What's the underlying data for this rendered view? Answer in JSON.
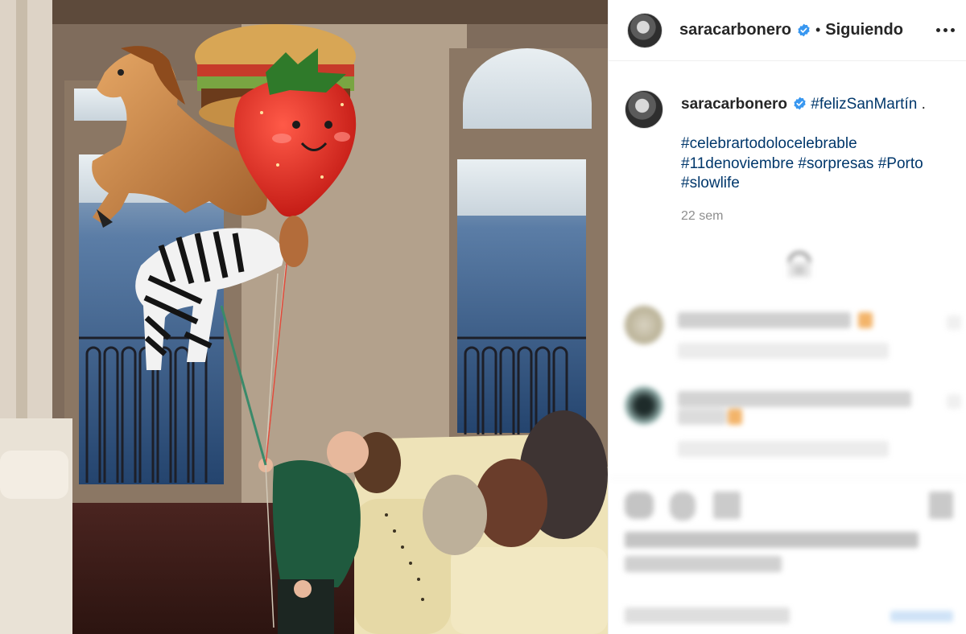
{
  "post": {
    "username": "saracarbonero",
    "separator": "•",
    "follow_status": "Siguiendo",
    "caption": {
      "username": "saracarbonero",
      "first_tag": "#felizSanMartín",
      "first_line_end": ".",
      "tags": [
        "#celebrartodolocelebrable",
        "#11denoviembre",
        "#sorpresas",
        "#Porto",
        "#slowlife"
      ],
      "time": "22 sem"
    }
  },
  "icons": {
    "verified": "verified-badge-icon",
    "more": "more-options-icon",
    "load_more": "load-more-comments-icon"
  },
  "colors": {
    "verified_blue": "#3897f0",
    "hashtag_blue": "#00376b",
    "muted_gray": "#8e8e8e"
  }
}
